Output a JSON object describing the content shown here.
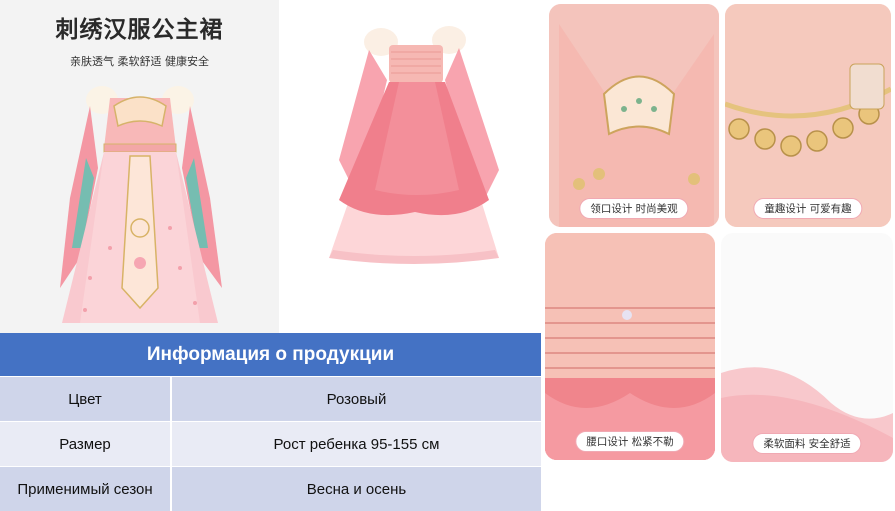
{
  "hero": {
    "title": "刺绣汉服公主裙",
    "subtitle": "亲肤透气  柔软舒适  健康安全"
  },
  "details": [
    {
      "caption": "领口设计 时尚美观"
    },
    {
      "caption": "童趣设计 可爱有趣"
    },
    {
      "caption": "腰口设计 松紧不勒"
    },
    {
      "caption": "柔软面料 安全舒适"
    }
  ],
  "info": {
    "heading": "Информация о продукции",
    "rows": [
      {
        "key": "Цвет",
        "value": "Розовый"
      },
      {
        "key": "Размер",
        "value": "Рост ребенка 95-155 см"
      },
      {
        "key": "Применимый сезон",
        "value": "Весна и осень"
      }
    ]
  },
  "colors": {
    "header_blue": "#4472c4",
    "row_dark": "#cfd5ea",
    "row_light": "#e9ebf5",
    "dress_pink": "#f08a94",
    "caption_border": "#f0a9b3"
  }
}
